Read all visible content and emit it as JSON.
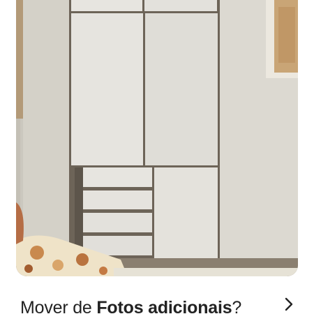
{
  "photo": {
    "subject": "white wardrobe with drawers"
  },
  "move_prompt": {
    "prefix": "Mover de ",
    "album_name": "Fotos adicionais",
    "suffix": "?"
  },
  "icons": {
    "chevron": "chevron-right-icon"
  }
}
